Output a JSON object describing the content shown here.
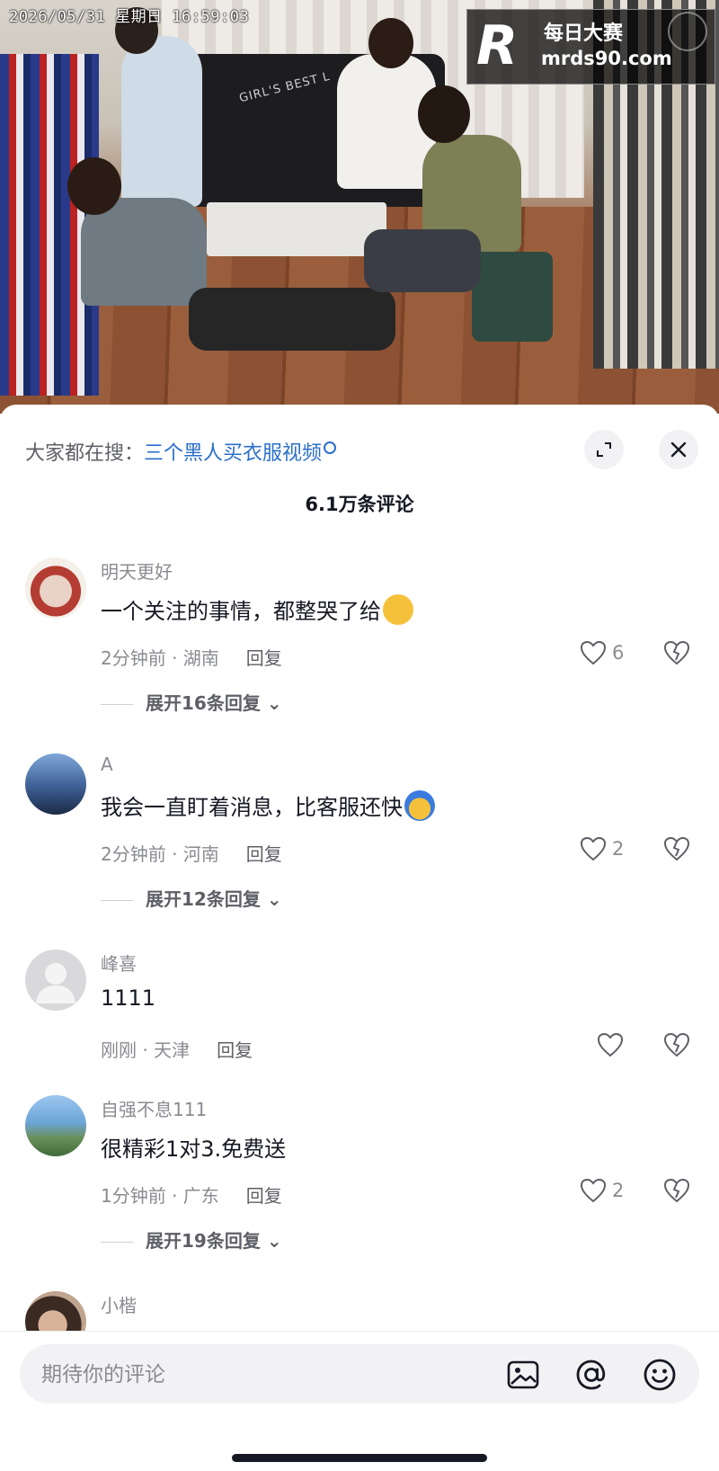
{
  "video": {
    "timestamp": "2026/05/31 星期日 16:59:03",
    "sofa_text": "GIRL'S BEST L",
    "logo_text_cn": "每日大赛",
    "logo_url": "mrds90.com"
  },
  "sheet": {
    "search_prefix": "大家都在搜：",
    "search_query": "三个黑人买衣服视频",
    "comment_count": "6.1万条评论"
  },
  "comments": [
    {
      "username": "明天更好",
      "text": "一个关注的事情，都整哭了给",
      "time_location": "2分钟前 · 湖南",
      "reply_label": "回复",
      "likes": "6",
      "expand_label": "展开16条回复"
    },
    {
      "username": "A",
      "text": "我会一直盯着消息，比客服还快",
      "time_location": "2分钟前 · 河南",
      "reply_label": "回复",
      "likes": "2",
      "expand_label": "展开12条回复"
    },
    {
      "username": "峰喜",
      "text": "1111",
      "time_location": "刚刚 · 天津",
      "reply_label": "回复",
      "likes": ""
    },
    {
      "username": "自强不息111",
      "text": "很精彩1对3.免费送",
      "time_location": "1分钟前 · 广东",
      "reply_label": "回复",
      "likes": "2",
      "expand_label": "展开19条回复"
    },
    {
      "username": "小楷"
    }
  ],
  "input": {
    "placeholder": "期待你的评论"
  },
  "icons": {
    "expand": "expand-icon",
    "close": "close-icon",
    "heart": "heart-icon",
    "broken_heart": "broken-heart-icon",
    "image": "image-icon",
    "mention": "at-icon",
    "emoji": "emoji-icon"
  },
  "colors": {
    "link_blue": "#2a6fc9",
    "secondary_text": "#8a8b91",
    "primary_text": "#161823"
  }
}
